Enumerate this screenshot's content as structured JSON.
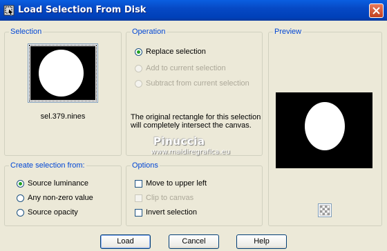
{
  "window": {
    "title": "Load Selection From Disk"
  },
  "selection": {
    "label": "Selection",
    "filename": "sel.379.nines"
  },
  "operation": {
    "label": "Operation",
    "options": [
      {
        "label": "Replace selection",
        "checked": true,
        "enabled": true
      },
      {
        "label": "Add to current selection",
        "checked": false,
        "enabled": false
      },
      {
        "label": "Subtract from current selection",
        "checked": false,
        "enabled": false
      }
    ],
    "info_line1": "The original rectangle for this selection",
    "info_line2": "will completely intersect the canvas."
  },
  "watermark": {
    "name": "Pinuccia",
    "url": "www.maidiregrafica.eu"
  },
  "preview": {
    "label": "Preview"
  },
  "create_from": {
    "label": "Create selection from:",
    "options": [
      {
        "label": "Source luminance",
        "checked": true
      },
      {
        "label": "Any non-zero value",
        "checked": false
      },
      {
        "label": "Source opacity",
        "checked": false
      }
    ]
  },
  "options": {
    "label": "Options",
    "items": [
      {
        "label": "Move to upper left",
        "checked": false,
        "enabled": true
      },
      {
        "label": "Clip to canvas",
        "checked": false,
        "enabled": false
      },
      {
        "label": "Invert selection",
        "checked": false,
        "enabled": true
      }
    ]
  },
  "buttons": {
    "load": "Load",
    "cancel": "Cancel",
    "help": "Help"
  },
  "icons": {
    "title": "selection-tool-icon",
    "close": "close-icon",
    "transparency": "checkerboard-icon"
  },
  "colors": {
    "group_label": "#0046d5",
    "titlebar": "#0649c5",
    "radio_dot": "#21a121"
  }
}
